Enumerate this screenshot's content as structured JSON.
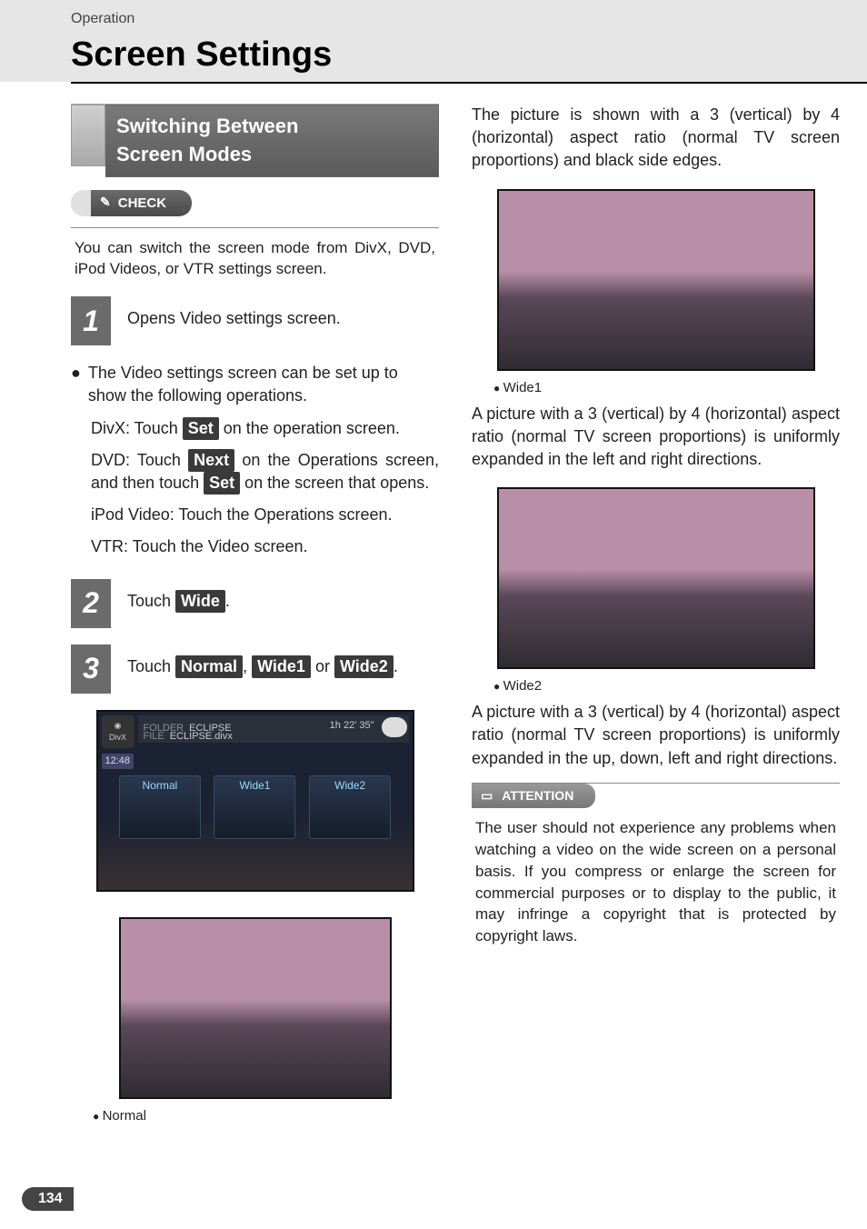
{
  "header": {
    "small": "Operation",
    "large": "Screen Settings"
  },
  "section_title_line1": "Switching Between",
  "section_title_line2": "Screen Modes",
  "check_label": "CHECK",
  "check_text": "You can switch the screen mode from DivX, DVD, iPod Videos, or VTR settings screen.",
  "steps": {
    "s1": {
      "num": "1",
      "text": "Opens Video settings screen."
    },
    "s2": {
      "num": "2",
      "pre": "Touch ",
      "btn": "Wide",
      "post": "."
    },
    "s3": {
      "num": "3",
      "pre": "Touch ",
      "b1": "Normal",
      "mid1": ", ",
      "b2": "Wide1",
      "mid2": " or ",
      "b3": "Wide2",
      "post": "."
    }
  },
  "bullet_text": "The Video settings screen can be set up to show the following operations.",
  "sub1": {
    "pre": "DivX: Touch ",
    "btn": "Set",
    "post": " on the operation screen."
  },
  "sub2": {
    "pre": "DVD: Touch ",
    "btn1": "Next",
    "mid": " on the Operations screen, and then touch ",
    "btn2": "Set",
    "post": " on the screen that opens."
  },
  "sub3": "iPod Video: Touch the Operations screen.",
  "sub4": "VTR: Touch the Video screen.",
  "screenshot": {
    "source": "DivX",
    "folder_label": "FOLDER",
    "folder": "ECLIPSE",
    "file_label": "FILE",
    "file": "ECLIPSE.divx",
    "duration": "1h 22' 35\"",
    "clock": "12:48",
    "modes": [
      "Normal",
      "Wide1",
      "Wide2"
    ]
  },
  "caption_normal": "Normal",
  "right": {
    "para1": "The picture is shown with a 3 (vertical) by 4 (horizontal) aspect ratio (normal TV screen proportions) and black side edges.",
    "cap1": "Wide1",
    "para2": "A picture with a 3 (vertical) by 4 (horizontal) aspect ratio (normal TV screen proportions) is uniformly expanded in the left and right directions.",
    "cap2": "Wide2",
    "para3": "A picture with a 3 (vertical) by 4 (horizontal) aspect ratio (normal TV screen proportions) is uniformly expanded in the up, down, left and right directions."
  },
  "attention_label": "ATTENTION",
  "attention_text": "The user should not experience any problems when watching a video on the wide screen on a personal basis. If you compress or enlarge the screen for commercial purposes or to display to the public, it may infringe a copyright that is protected by copyright laws.",
  "page_number": "134"
}
